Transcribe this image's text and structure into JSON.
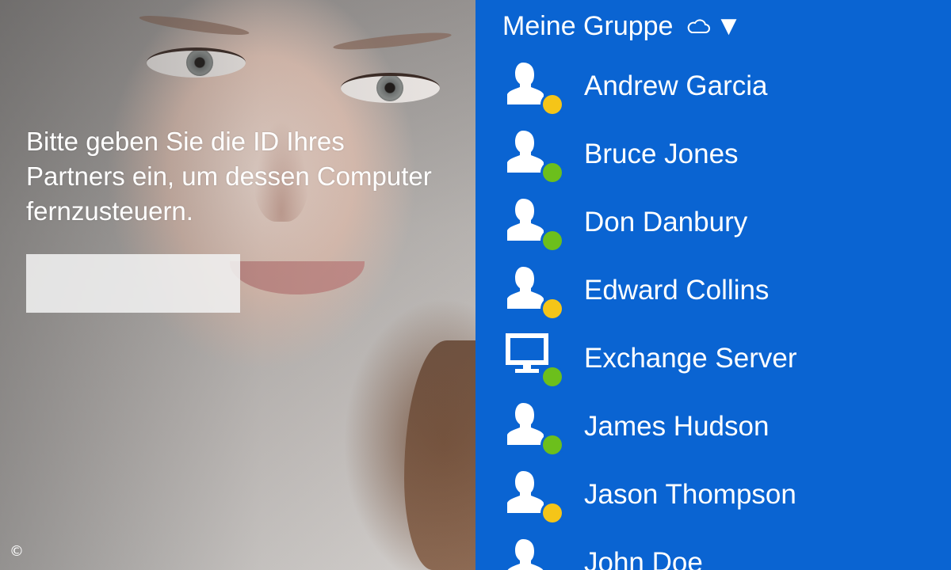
{
  "left": {
    "prompt": "Bitte geben Sie die ID Ihres Partners ein, um dessen Computer fernzusteuern.",
    "partner_id_value": "",
    "copyright": "©"
  },
  "group": {
    "title": "Meine Gruppe",
    "cloud_icon": "cloud-icon",
    "dropdown_glyph": "▼"
  },
  "colors": {
    "panel_blue": "#0a64d2",
    "status_away": "#f5c518",
    "status_online": "#6cbf1c"
  },
  "contacts": [
    {
      "name": "Andrew Garcia",
      "type": "person",
      "status": "away"
    },
    {
      "name": "Bruce Jones",
      "type": "person",
      "status": "online"
    },
    {
      "name": "Don Danbury",
      "type": "person",
      "status": "online"
    },
    {
      "name": "Edward Collins",
      "type": "person",
      "status": "away"
    },
    {
      "name": "Exchange Server",
      "type": "computer",
      "status": "online"
    },
    {
      "name": "James Hudson",
      "type": "person",
      "status": "online"
    },
    {
      "name": "Jason Thompson",
      "type": "person",
      "status": "away"
    },
    {
      "name": "John Doe",
      "type": "person",
      "status": "online"
    }
  ]
}
